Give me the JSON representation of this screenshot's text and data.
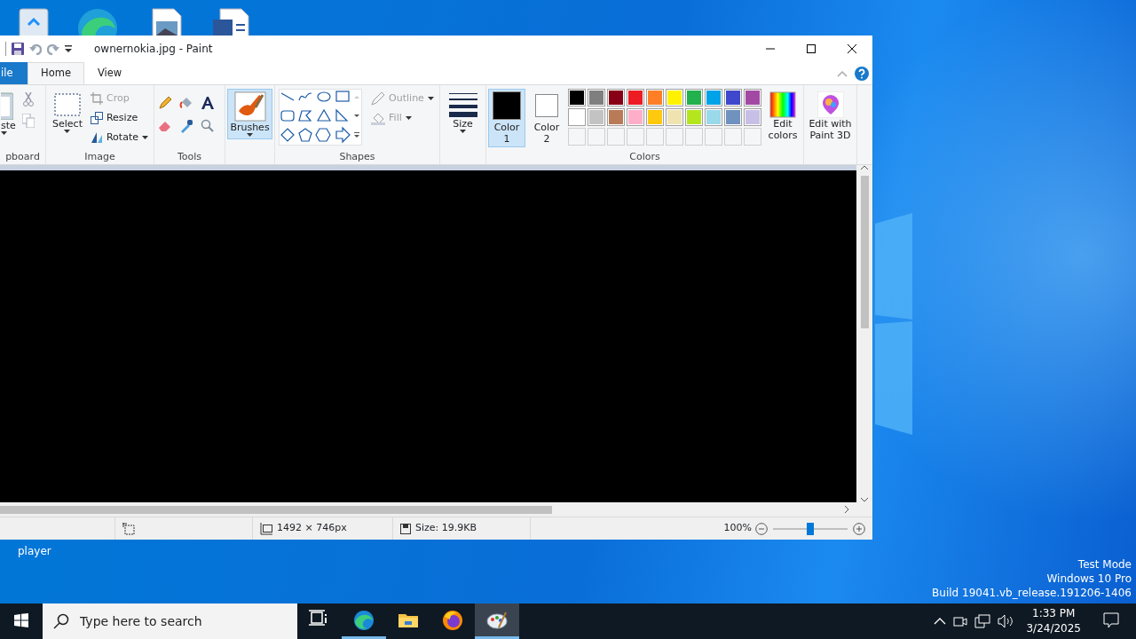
{
  "window": {
    "title": "ownernokia.jpg - Paint"
  },
  "ribbon_tabs": [
    {
      "label": "ile",
      "kind": "file",
      "selected": false
    },
    {
      "label": "Home",
      "kind": "tab",
      "selected": true
    },
    {
      "label": "View",
      "kind": "tab",
      "selected": false
    }
  ],
  "clipboard": {
    "paste": "ste",
    "group_label": "pboard"
  },
  "image": {
    "select": "Select",
    "crop": {
      "label": "Crop",
      "disabled": true
    },
    "resize": {
      "label": "Resize",
      "disabled": false
    },
    "rotate": {
      "label": "Rotate",
      "disabled": false
    },
    "group_label": "Image"
  },
  "tools": {
    "group_label": "Tools"
  },
  "brushes": {
    "label": "Brushes",
    "selected": true
  },
  "shapes": {
    "outline": {
      "label": "Outline",
      "disabled": true
    },
    "fill": {
      "label": "Fill",
      "disabled": true
    },
    "group_label": "Shapes"
  },
  "size": {
    "label": "Size"
  },
  "colors": {
    "color1": {
      "label": "Color 1",
      "color": "#000000",
      "selected": true
    },
    "color2": {
      "label": "Color 2",
      "color": "#ffffff",
      "selected": false
    },
    "palette": [
      {
        "color": "#000000"
      },
      {
        "color": "#7f7f7f"
      },
      {
        "color": "#880015"
      },
      {
        "color": "#ed1c24"
      },
      {
        "color": "#ff7f27"
      },
      {
        "color": "#fff200"
      },
      {
        "color": "#22b14c"
      },
      {
        "color": "#00a2e8"
      },
      {
        "color": "#3f48cc"
      },
      {
        "color": "#a349a4"
      },
      {
        "color": "#ffffff"
      },
      {
        "color": "#c3c3c3"
      },
      {
        "color": "#b97a57"
      },
      {
        "color": "#ffaec9"
      },
      {
        "color": "#ffc90e"
      },
      {
        "color": "#efe4b0"
      },
      {
        "color": "#b5e61d"
      },
      {
        "color": "#99d9ea"
      },
      {
        "color": "#7092be"
      },
      {
        "color": "#c8bfe7"
      }
    ],
    "edit_colors": "Edit colors",
    "group_label": "Colors"
  },
  "paint3d": {
    "label": "Edit with Paint 3D"
  },
  "status_bar": {
    "dimensions": "1492 × 746px",
    "file_size": "Size: 19.9KB",
    "zoom": "100%",
    "zoom_level": {
      "level": 0.5
    }
  },
  "desktop": {
    "icon_label": "player",
    "system_text": [
      "Test Mode",
      "Windows 10 Pro",
      "Build 19041.vb_release.191206-1406"
    ]
  },
  "taskbar": {
    "search": {
      "placeholder": "Type here to search"
    },
    "apps": [
      {
        "kind": "task-view",
        "running": false,
        "active": false
      },
      {
        "kind": "edge",
        "running": true,
        "active": false
      },
      {
        "kind": "explorer",
        "running": false,
        "active": false
      },
      {
        "kind": "firefox",
        "running": false,
        "active": false
      },
      {
        "kind": "paint",
        "running": true,
        "active": true
      }
    ],
    "time": "1:33 PM",
    "date": "3/24/2025"
  }
}
